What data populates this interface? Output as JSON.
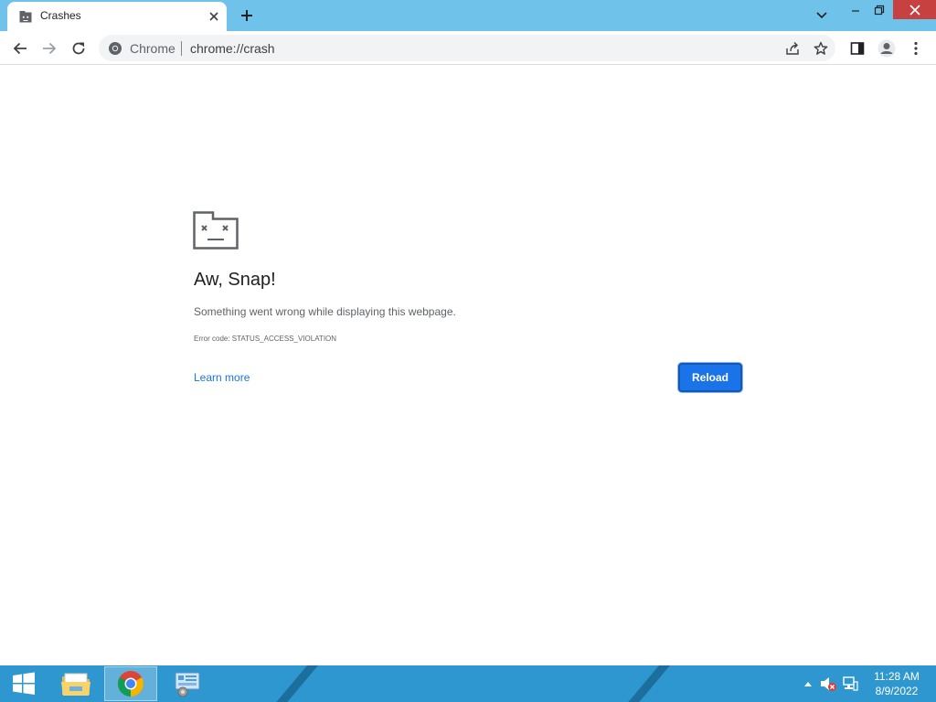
{
  "tab": {
    "title": "Crashes",
    "favicon": "sad-tab-icon",
    "close_icon": "close-icon"
  },
  "toolbar": {
    "omnibox": {
      "chip": "Chrome",
      "url": "chrome://crash"
    }
  },
  "error_page": {
    "title": "Aw, Snap!",
    "message": "Something went wrong while displaying this webpage.",
    "error_code": "Error code: STATUS_ACCESS_VIOLATION",
    "learn_more": "Learn more",
    "reload": "Reload"
  },
  "taskbar": {
    "items": [
      "file-explorer-icon",
      "chrome-icon",
      "control-panel-icon"
    ],
    "active_item": "chrome-icon",
    "clock": {
      "time": "11:28 AM",
      "date": "8/9/2022"
    }
  },
  "colors": {
    "titlebar": "#6fc3ea",
    "accent": "#1a73e8",
    "taskbar": "#2f97cf",
    "close_button": "#c74141"
  }
}
